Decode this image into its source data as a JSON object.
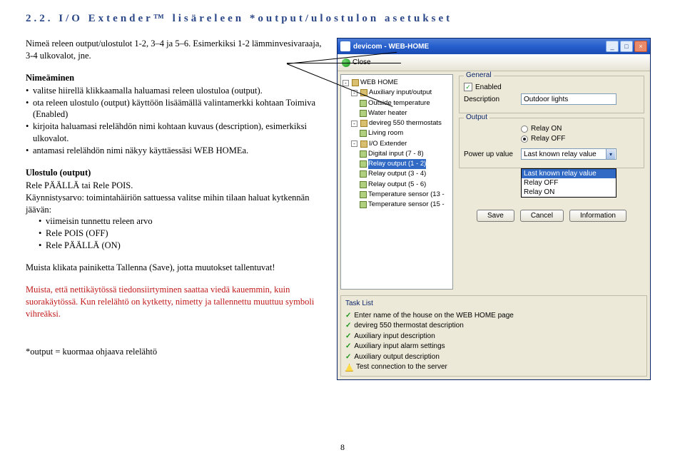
{
  "heading": "2.2. I/O Extender™ lisäreleen *output/ulostulon asetukset",
  "para1": "Nimeä releen output/ulostulot 1-2, 3–4 ja 5–6. Esimerkiksi 1-2 lämminvesivaraaja, 3-4 ulkovalot, jne.",
  "s1_title": "Nimeäminen",
  "s1_items": [
    "valitse hiirellä klikkaamalla haluamasi releen ulostuloa (output).",
    "ota releen ulostulo (output) käyttöön lisäämällä valintamerkki kohtaan Toimiva (Enabled)",
    "kirjoita haluamasi relelähdön nimi kohtaan kuvaus (description), esimerkiksi ulkovalot.",
    "antamasi relelähdön nimi näkyy käyttäessäsi WEB HOMEa."
  ],
  "s2_title": "Ulostulo (output)",
  "s2_line1": "Rele PÄÄLLÄ tai Rele POIS.",
  "s2_line2": "Käynnistysarvo: toimintahäiriön sattuessa valitse mihin tilaan haluat kytkennän jäävän:",
  "s2_items": [
    "viimeisin tunnettu releen arvo",
    "Rele POIS (OFF)",
    "Rele PÄÄLLÄ (ON)"
  ],
  "para2": "Muista klikata painiketta Tallenna (Save), jotta muutokset tallentuvat!",
  "para3": "Muista, että nettikäytössä tiedonsiirtyminen saattaa viedä kauemmin, kuin suorakäytössä. Kun relelähtö on kytketty, nimetty ja tallennettu muuttuu symboli vihreäksi.",
  "footnote": "*output = kuormaa ohjaava relelähtö",
  "pagenum": "8",
  "win": {
    "title": "devicom - WEB-HOME",
    "close": "Close",
    "tree": {
      "root": "WEB HOME",
      "n1": "Auxiliary input/output",
      "n2": "Outside temperature",
      "n3": "Water heater",
      "n4": "devireg 550 thermostats",
      "n5": "Living room",
      "n6": "I/O Extender",
      "n7": "Digital input (7 - 8)",
      "n8": "Relay output (1 - 2)",
      "n9": "Relay output (3 - 4)",
      "n10": "Relay output (5 - 6)",
      "n11": "Temperature sensor (13 -",
      "n12": "Temperature sensor (15 -"
    },
    "general": {
      "title": "General",
      "enabled": "Enabled",
      "desc": "Description",
      "desc_val": "Outdoor lights"
    },
    "output": {
      "title": "Output",
      "ron": "Relay ON",
      "roff": "Relay OFF",
      "pow": "Power up value",
      "dd_sel": "Last known relay value",
      "dd_o1": "Last known relay value",
      "dd_o2": "Relay OFF",
      "dd_o3": "Relay ON"
    },
    "btns": {
      "save": "Save",
      "cancel": "Cancel",
      "info": "Information"
    },
    "tasklist": {
      "title": "Task List",
      "t1": "Enter name of the house on the WEB HOME page",
      "t2": "devireg 550 thermostat description",
      "t3": "Auxiliary input description",
      "t4": "Auxiliary input alarm settings",
      "t5": "Auxiliary output description",
      "t6": "Test connection to the server"
    }
  }
}
